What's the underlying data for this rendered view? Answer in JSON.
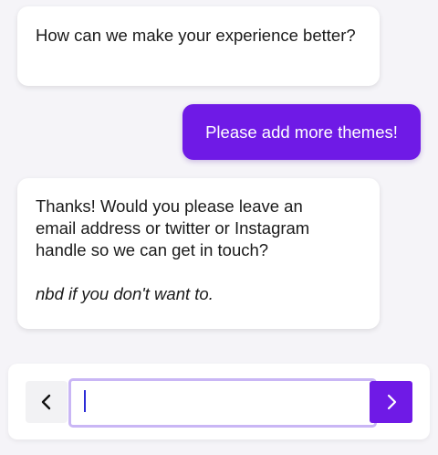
{
  "messages": [
    {
      "from": "bot",
      "text": "How can we make your experience better?"
    },
    {
      "from": "user",
      "text": "Please add more themes!"
    },
    {
      "from": "bot",
      "lines": [
        "Thanks! Would you please leave an",
        "email address or twitter or Instagram",
        "handle so we can get in touch?"
      ],
      "note": "nbd if you don't want to."
    }
  ],
  "composer": {
    "input_value": "",
    "back_icon": "chevron-left-icon",
    "send_icon": "chevron-right-icon"
  },
  "colors": {
    "accent": "#6f1ae6",
    "background": "#f5f4f8",
    "input_focus_border": "#c9b6f5"
  }
}
